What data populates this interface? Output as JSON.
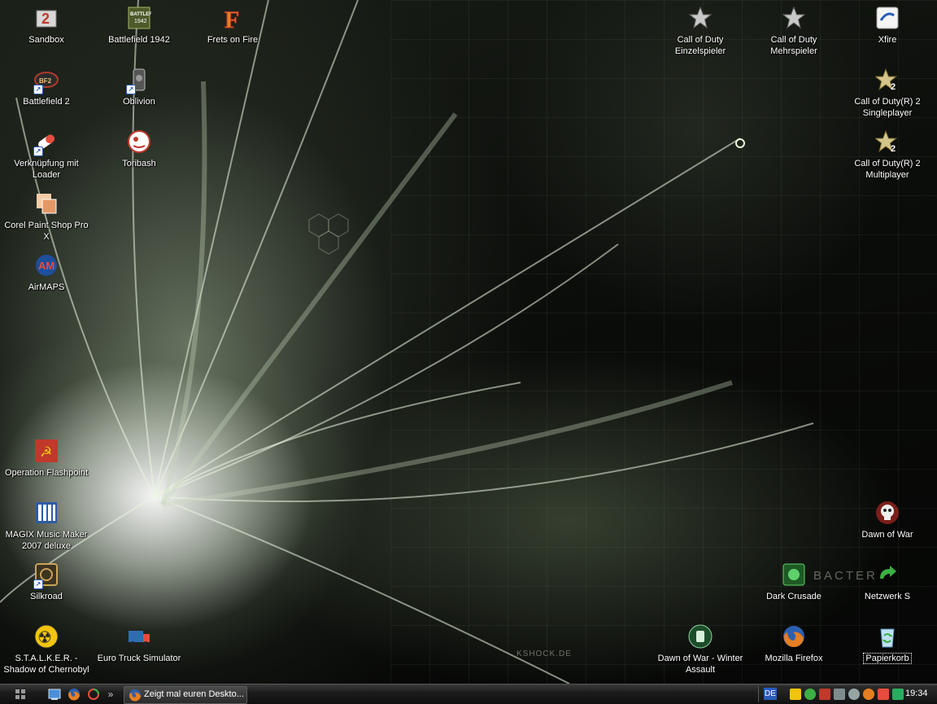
{
  "desktop": {
    "icons": [
      {
        "id": "sandbox",
        "label": "Sandbox",
        "icon": "sandbox-icon",
        "color": "#c0392b"
      },
      {
        "id": "bf1942",
        "label": "Battlefield 1942",
        "icon": "battlefield-1942-icon",
        "color": "#6b7a3a"
      },
      {
        "id": "frets",
        "label": "Frets on Fire",
        "icon": "frets-on-fire-icon",
        "color": "#e67e22"
      },
      {
        "id": "cod-sp",
        "label": "Call of Duty\nEinzelspieler",
        "icon": "call-of-duty-star-icon",
        "color": "#c8c8c8"
      },
      {
        "id": "cod-mp",
        "label": "Call of Duty\nMehrspieler",
        "icon": "call-of-duty-star-icon",
        "color": "#c8c8c8"
      },
      {
        "id": "xfire",
        "label": "Xfire",
        "icon": "xfire-icon",
        "color": "#ffffff"
      },
      {
        "id": "bf2",
        "label": "Battlefield 2",
        "icon": "battlefield-2-icon",
        "color": "#b03a2e"
      },
      {
        "id": "oblivion",
        "label": "Oblivion",
        "icon": "oblivion-icon",
        "color": "#555555"
      },
      {
        "id": "cod2-sp",
        "label": "Call of Duty(R) 2\nSingleplayer",
        "icon": "call-of-duty-2-icon",
        "color": "#d4c58a"
      },
      {
        "id": "loader",
        "label": "Verknüpfung mit\nLoader",
        "icon": "pill-icon",
        "color": "#e74c3c"
      },
      {
        "id": "toribash",
        "label": "Toribash",
        "icon": "toribash-icon",
        "color": "#c0392b"
      },
      {
        "id": "cod2-mp",
        "label": "Call of Duty(R) 2\nMultiplayer",
        "icon": "call-of-duty-2-icon",
        "color": "#d4c58a"
      },
      {
        "id": "paintshop",
        "label": "Corel Paint Shop Pro X",
        "icon": "paint-shop-pro-icon",
        "color": "#f0b27a"
      },
      {
        "id": "airmaps",
        "label": "AirMAPS",
        "icon": "airmaps-icon",
        "color": "#1f4e9c"
      },
      {
        "id": "ofp",
        "label": "Operation Flashpoint",
        "icon": "operation-flashpoint-icon",
        "color": "#c0392b"
      },
      {
        "id": "magix",
        "label": "MAGIX Music Maker\n2007 deluxe",
        "icon": "magix-piano-icon",
        "color": "#2e5aa8"
      },
      {
        "id": "dow",
        "label": "Dawn of War",
        "icon": "dawn-of-war-skull-icon",
        "color": "#b03a2e"
      },
      {
        "id": "silkroad",
        "label": "Silkroad",
        "icon": "silkroad-icon",
        "color": "#8d6e3a"
      },
      {
        "id": "darkcrusade",
        "label": "Dark Crusade",
        "icon": "dark-crusade-icon",
        "color": "#2e8b3a"
      },
      {
        "id": "netzwerk",
        "label": "Netzwerk S",
        "icon": "network-icon",
        "color": "#3cb043"
      },
      {
        "id": "stalker",
        "label": "S.T.A.L.K.E.R. -\nShadow of Chernobyl",
        "icon": "radiation-icon",
        "color": "#f1c40f"
      },
      {
        "id": "ets",
        "label": "Euro Truck Simulator",
        "icon": "truck-icon",
        "color": "#2e6db4"
      },
      {
        "id": "dow-wa",
        "label": "Dawn of War - Winter\nAssault",
        "icon": "winter-assault-icon",
        "color": "#3a8a4a"
      },
      {
        "id": "firefox",
        "label": "Mozilla Firefox",
        "icon": "firefox-icon",
        "color": "#e67e22"
      },
      {
        "id": "papierkorb",
        "label": "Papierkorb",
        "icon": "recycle-bin-icon",
        "color": "#7fb8e0"
      }
    ],
    "wallpaper_text": [
      "BACTER",
      "KSHOCK.DE"
    ]
  },
  "taskbar": {
    "quicklaunch_more": "»",
    "task_label": "Zeigt mal euren Deskto...",
    "language": "DE",
    "clock": "19:34"
  }
}
